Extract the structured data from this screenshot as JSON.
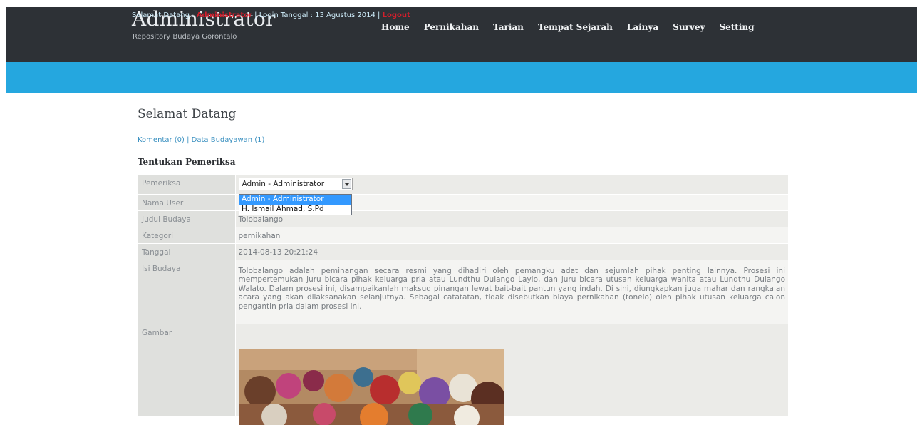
{
  "header": {
    "title": "Administrator",
    "subtitle": "Repository Budaya Gorontalo",
    "nav": [
      "Home",
      "Pernikahan",
      "Tarian",
      "Tempat Sejarah",
      "Lainya",
      "Survey",
      "Setting"
    ]
  },
  "subbar": {
    "greeting": "Selamat Datang :",
    "user": "Administrator",
    "login_text": "| Login Tanggal : 13 Agustus 2014 |",
    "logout": "Logout"
  },
  "main": {
    "title": "Selamat Datang",
    "link_komentar": "Komentar (0)",
    "separator": "|",
    "link_data": "Data Budayawan (1)",
    "section_title": "Tentukan Pemeriksa"
  },
  "form": {
    "pemeriksa_label": "Pemeriksa",
    "pemeriksa_selected": "Admin - Administrator",
    "pemeriksa_options": [
      "Admin - Administrator",
      "H. Ismail Ahmad, S.Pd"
    ],
    "nama_user_label": "Nama User",
    "nama_user_value": "",
    "judul_label": "Judul Budaya",
    "judul_value": "Tolobalango",
    "kategori_label": "Kategori",
    "kategori_value": "pernikahan",
    "tanggal_label": "Tanggal",
    "tanggal_value": "2014-08-13 20:21:24",
    "isi_label": "Isi Budaya",
    "isi_value": "Tolobalango adalah peminangan secara resmi yang dihadiri oleh pemangku adat dan sejumlah pihak penting lainnya. Prosesi ini mempertemukan juru bicara pihak keluarga pria atau Lundthu Dulango Layio, dan juru bicara utusan keluarga wanita atau Lundthu Dulango Walato. Dalam prosesi ini, disampaikanlah maksud pinangan lewat bait-bait pantun yang indah. Di sini, diungkapkan juga mahar dan rangkaian acara yang akan dilaksanakan selanjutnya. Sebagai catatatan, tidak disebutkan biaya pernikahan (tonelo) oleh pihak utusan keluarga calon pengantin pria dalam prosesi ini.",
    "gambar_label": "Gambar"
  }
}
